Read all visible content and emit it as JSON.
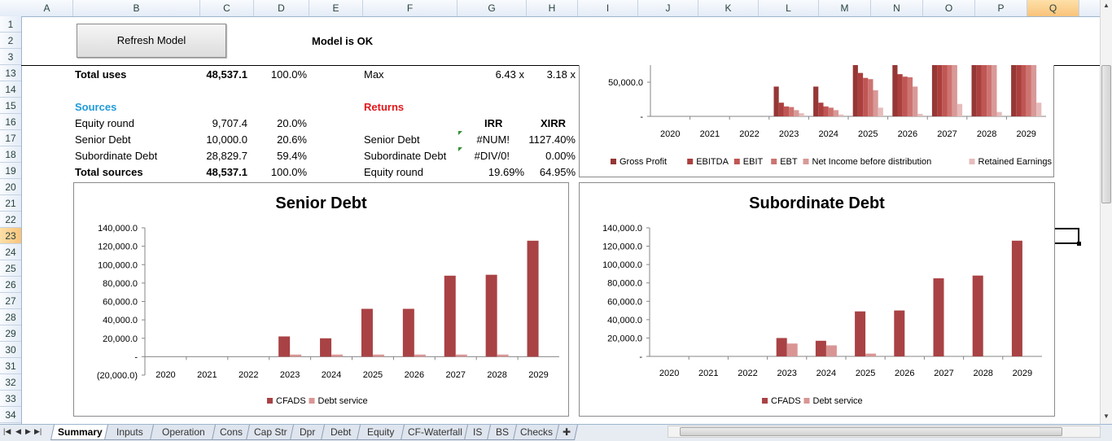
{
  "columns": [
    "A",
    "B",
    "C",
    "D",
    "E",
    "F",
    "G",
    "H",
    "I",
    "J",
    "K",
    "L",
    "M",
    "N",
    "O",
    "P",
    "Q"
  ],
  "selected_column": "Q",
  "rows": [
    "1",
    "2",
    "3",
    "13",
    "14",
    "15",
    "16",
    "17",
    "18",
    "19",
    "20",
    "21",
    "22",
    "23",
    "24",
    "25",
    "26",
    "27",
    "28",
    "29",
    "30",
    "31",
    "32",
    "33",
    "34"
  ],
  "selected_row": "23",
  "refresh_button": "Refresh Model",
  "status": "Model is OK",
  "uses": {
    "label": "Total uses",
    "value": "48,537.1",
    "pct": "100.0%"
  },
  "sources": {
    "header": "Sources",
    "items": [
      {
        "label": "Equity round",
        "value": "9,707.4",
        "pct": "20.0%"
      },
      {
        "label": "Senior Debt",
        "value": "10,000.0",
        "pct": "20.6%"
      },
      {
        "label": "Subordinate Debt",
        "value": "28,829.7",
        "pct": "59.4%"
      }
    ],
    "total": {
      "label": "Total sources",
      "value": "48,537.1",
      "pct": "100.0%"
    }
  },
  "max_row": {
    "label": "Max",
    "g": "6.43 x",
    "h": "3.18 x"
  },
  "returns": {
    "header": "Returns",
    "col_irr": "IRR",
    "col_xirr": "XIRR",
    "items": [
      {
        "label": "Senior Debt",
        "irr": "#NUM!",
        "xirr": "1127.40%"
      },
      {
        "label": "Subordinate Debt",
        "irr": "#DIV/0!",
        "xirr": "0.00%"
      },
      {
        "label": "Equity round",
        "irr": "19.69%",
        "xirr": "64.95%"
      }
    ]
  },
  "colors": {
    "cfads": "#a94244",
    "debt_service": "#d99594",
    "pl": [
      "#953735",
      "#ab3f3e",
      "#bf5654",
      "#cd7471",
      "#d89997",
      "#e6bcbb"
    ]
  },
  "chart_data": [
    {
      "type": "bar",
      "title": "",
      "categories": [
        "2020",
        "2021",
        "2022",
        "2023",
        "2024",
        "2025",
        "2026",
        "2027",
        "2028",
        "2029"
      ],
      "ytick_labels": [
        "50,000.0",
        "-"
      ],
      "ylim": [
        0,
        80000
      ],
      "series": [
        {
          "name": "Gross Profit",
          "values": [
            0,
            0,
            0,
            48000,
            48000,
            95000,
            110000,
            165000,
            195000,
            230000
          ]
        },
        {
          "name": "EBITDA",
          "values": [
            0,
            0,
            0,
            22000,
            22000,
            70000,
            68000,
            150000,
            180000,
            215000
          ]
        },
        {
          "name": "EBIT",
          "values": [
            0,
            0,
            0,
            16000,
            16000,
            62000,
            64000,
            140000,
            170000,
            200000
          ]
        },
        {
          "name": "EBT",
          "values": [
            0,
            0,
            0,
            15000,
            14000,
            60000,
            63000,
            130000,
            160000,
            180000
          ]
        },
        {
          "name": "Net Income before distribution",
          "values": [
            0,
            0,
            0,
            10000,
            10000,
            42000,
            48000,
            95000,
            110000,
            130000
          ]
        },
        {
          "name": "Retained Earnings",
          "values": [
            0,
            0,
            0,
            5000,
            3000,
            14000,
            4000,
            20000,
            7000,
            22000
          ]
        }
      ],
      "legend": "bottom"
    },
    {
      "type": "bar",
      "title": "Senior Debt",
      "categories": [
        "2020",
        "2021",
        "2022",
        "2023",
        "2024",
        "2025",
        "2026",
        "2027",
        "2028",
        "2029"
      ],
      "ytick_labels": [
        "140,000.0",
        "120,000.0",
        "100,000.0",
        "80,000.0",
        "60,000.0",
        "40,000.0",
        "20,000.0",
        "-",
        "(20,000.0)"
      ],
      "ylim": [
        -20000,
        140000
      ],
      "series": [
        {
          "name": "CFADS",
          "values": [
            0,
            0,
            0,
            22000,
            20000,
            52000,
            52000,
            88000,
            89000,
            126000
          ]
        },
        {
          "name": "Debt service",
          "values": [
            0,
            0,
            0,
            2300,
            2300,
            2300,
            2300,
            2300,
            2300,
            0
          ]
        }
      ],
      "legend": "bottom"
    },
    {
      "type": "bar",
      "title": "Subordinate Debt",
      "categories": [
        "2020",
        "2021",
        "2022",
        "2023",
        "2024",
        "2025",
        "2026",
        "2027",
        "2028",
        "2029"
      ],
      "ytick_labels": [
        "140,000.0",
        "120,000.0",
        "100,000.0",
        "80,000.0",
        "60,000.0",
        "40,000.0",
        "20,000.0",
        "-"
      ],
      "ylim": [
        0,
        140000
      ],
      "series": [
        {
          "name": "CFADS",
          "values": [
            0,
            0,
            0,
            20000,
            17000,
            49000,
            50000,
            85000,
            88000,
            126000
          ]
        },
        {
          "name": "Debt service",
          "values": [
            0,
            0,
            0,
            14000,
            12000,
            3000,
            0,
            0,
            0,
            0
          ]
        }
      ],
      "legend": "bottom"
    }
  ],
  "sheet_tabs": [
    "Summary",
    "Inputs",
    "Operation",
    "Cons",
    "Cap Str",
    "Dpr",
    "Debt",
    "Equity",
    "CF-Waterfall",
    "IS",
    "BS",
    "Checks"
  ],
  "active_tab": "Summary",
  "icons": [
    "nav-first-icon",
    "nav-prev-icon",
    "nav-next-icon",
    "nav-last-icon",
    "insert-sheet-icon",
    "scroll-up-icon",
    "scroll-down-icon"
  ]
}
